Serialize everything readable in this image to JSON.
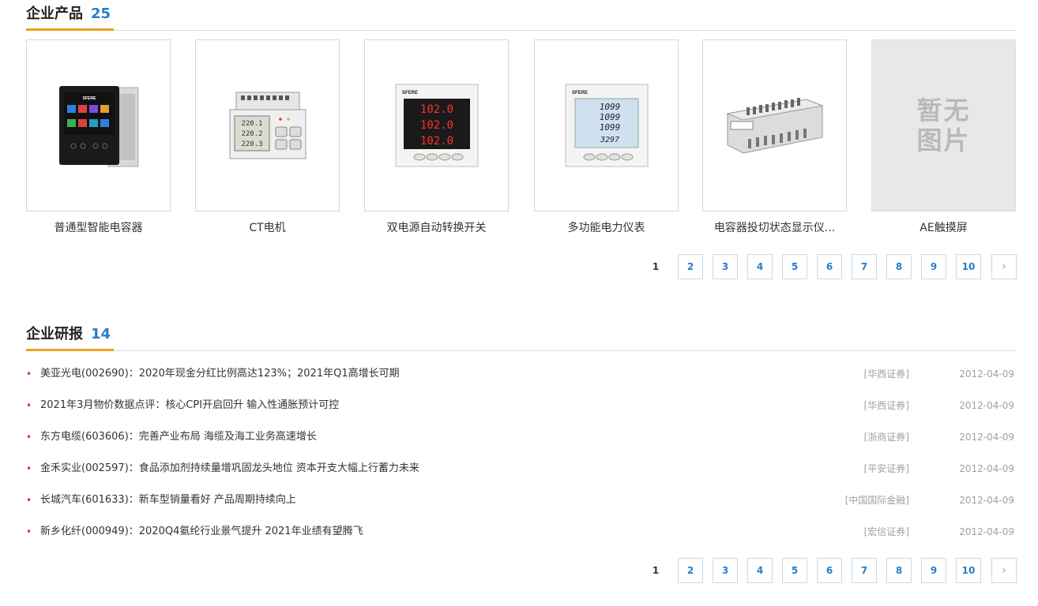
{
  "products": {
    "title": "企业产品",
    "count": "25",
    "items": [
      {
        "name": "普通型智能电容器"
      },
      {
        "name": "CT电机"
      },
      {
        "name": "双电源自动转换开关"
      },
      {
        "name": "多功能电力仪表"
      },
      {
        "name": "电容器投切状态显示仪..."
      },
      {
        "name": "AE触摸屏",
        "placeholder": "暂无\n图片"
      }
    ],
    "pagination": {
      "pages": [
        "1",
        "2",
        "3",
        "4",
        "5",
        "6",
        "7",
        "8",
        "9",
        "10"
      ],
      "current": "1",
      "next": "›"
    }
  },
  "reports": {
    "title": "企业研报",
    "count": "14",
    "items": [
      {
        "title": "美亚光电(002690)：2020年现金分红比例高达123%；2021年Q1高增长可期",
        "source": "[华西证券]",
        "date": "2012-04-09"
      },
      {
        "title": "2021年3月物价数据点评：核心CPI开启回升 输入性通胀预计可控",
        "source": "[华西证券]",
        "date": "2012-04-09"
      },
      {
        "title": "东方电缆(603606)：完善产业布局 海缆及海工业务高速增长",
        "source": "[浙商证券]",
        "date": "2012-04-09"
      },
      {
        "title": "金禾实业(002597)：食品添加剂持续量增巩固龙头地位 资本开支大幅上行蓄力未来",
        "source": "[平安证券]",
        "date": "2012-04-09"
      },
      {
        "title": "长城汽车(601633)：新车型销量看好 产品周期持续向上",
        "source": "[中国国际金融]",
        "date": "2012-04-09"
      },
      {
        "title": "新乡化纤(000949)：2020Q4氨纶行业景气提升 2021年业绩有望腾飞",
        "source": "[宏信证券]",
        "date": "2012-04-09"
      }
    ],
    "pagination": {
      "pages": [
        "1",
        "2",
        "3",
        "4",
        "5",
        "6",
        "7",
        "8",
        "9",
        "10"
      ],
      "current": "1",
      "next": "›"
    }
  },
  "device_text": {
    "brand": "SFERE",
    "meter_rows": [
      "102.0",
      "102.0",
      "102.0"
    ],
    "lcd_rows": [
      "1099",
      "1099",
      "1099",
      "3297"
    ],
    "ct_rows": [
      "220.1",
      "220.2",
      "220.3"
    ]
  },
  "colors": {
    "accent": "#f0a020",
    "link": "#2c7cc1",
    "bullet": "#d0382b"
  }
}
